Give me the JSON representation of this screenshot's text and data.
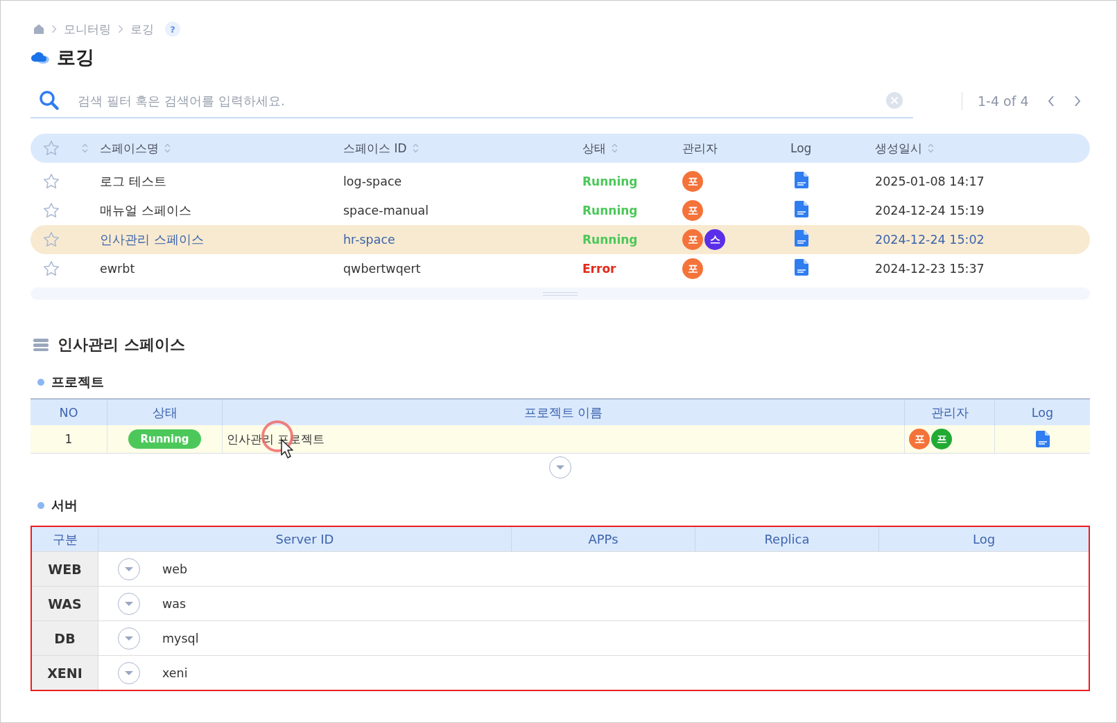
{
  "breadcrumb": {
    "items": [
      {
        "label": "모니터링"
      },
      {
        "label": "로깅"
      }
    ],
    "help": "?"
  },
  "page_title": "로깅",
  "search": {
    "placeholder": "검색 필터 혹은 검색어를 입력하세요."
  },
  "pagination": {
    "range": "1-4 of 4"
  },
  "spaces_table": {
    "columns": [
      {
        "label": "스페이스명",
        "sortable": true
      },
      {
        "label": "스페이스 ID",
        "sortable": true
      },
      {
        "label": "상태",
        "sortable": true
      },
      {
        "label": "관리자",
        "sortable": false
      },
      {
        "label": "Log",
        "sortable": false
      },
      {
        "label": "생성일시",
        "sortable": true
      }
    ],
    "rows": [
      {
        "favorite": false,
        "name": "로그 테스트",
        "space_id": "log-space",
        "status": "Running",
        "kind": "running",
        "managers": [
          {
            "initial": "포",
            "color": "#f4733a"
          }
        ],
        "created": "2025-01-08 14:17",
        "selected": false
      },
      {
        "favorite": false,
        "name": "매뉴얼 스페이스",
        "space_id": "space-manual",
        "status": "Running",
        "kind": "running",
        "managers": [
          {
            "initial": "포",
            "color": "#f4733a"
          }
        ],
        "created": "2024-12-24 15:19",
        "selected": false
      },
      {
        "favorite": false,
        "name": "인사관리 스페이스",
        "space_id": "hr-space",
        "status": "Running",
        "kind": "running",
        "managers": [
          {
            "initial": "포",
            "color": "#f4733a"
          },
          {
            "initial": "스",
            "color": "#5b2ee8"
          }
        ],
        "created": "2024-12-24 15:02",
        "selected": true
      },
      {
        "favorite": false,
        "name": "ewrbt",
        "space_id": "qwbertwqert",
        "status": "Error",
        "kind": "error",
        "managers": [
          {
            "initial": "포",
            "color": "#f4733a"
          }
        ],
        "created": "2024-12-23 15:37",
        "selected": false
      }
    ]
  },
  "detail": {
    "title": "인사관리 스페이스",
    "project": {
      "title": "프로젝트",
      "columns": [
        "NO",
        "상태",
        "프로젝트 이름",
        "관리자",
        "Log"
      ],
      "rows": [
        {
          "no": "1",
          "status": "Running",
          "kind": "running",
          "name": "인사관리 프로젝트",
          "managers": [
            {
              "initial": "포",
              "color": "#f4733a"
            },
            {
              "initial": "프",
              "color": "#22aa33"
            }
          ]
        }
      ],
      "expanded": false
    },
    "server": {
      "title": "서버",
      "highlighted": true,
      "columns": [
        "구분",
        "Server ID",
        "APPs",
        "Replica",
        "Log"
      ],
      "rows": [
        {
          "category": "WEB",
          "server_id": "web",
          "expanded": false
        },
        {
          "category": "WAS",
          "server_id": "was",
          "expanded": false
        },
        {
          "category": "DB",
          "server_id": "mysql",
          "expanded": false
        },
        {
          "category": "XENI",
          "server_id": "xeni",
          "expanded": false
        }
      ]
    }
  }
}
